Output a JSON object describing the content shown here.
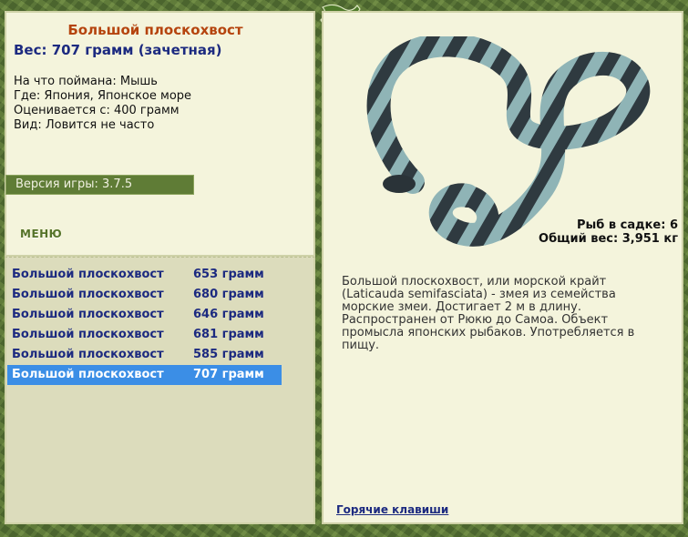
{
  "fish": {
    "title": "Большой плоскохвост",
    "weight": "Вес: 707 грамм (зачетная)",
    "details": [
      "На что поймана: Мышь",
      "Где: Япония, Японское море",
      "Оценивается с: 400 грамм",
      "Вид: Ловится не часто"
    ]
  },
  "version": "Версия игры: 3.7.5",
  "menu_label": "МЕНЮ",
  "stats": {
    "fish_in_keepnet": "Рыб в садке: 6",
    "total_weight": "Общий вес: 3,951 кг"
  },
  "catches": [
    {
      "name": "Большой плоскохвост",
      "weight": "653 грамм"
    },
    {
      "name": "Большой плоскохвост",
      "weight": "680 грамм"
    },
    {
      "name": "Большой плоскохвост",
      "weight": "646 грамм"
    },
    {
      "name": "Большой плоскохвост",
      "weight": "681 грамм"
    },
    {
      "name": "Большой плоскохвост",
      "weight": "585 грамм"
    },
    {
      "name": "Большой плоскохвост",
      "weight": "707 грамм"
    }
  ],
  "selected_catch_index": 5,
  "description": "Большой плоскохвост, или морской крайт (Laticauda semifasciata) - змея из семейства морские змеи. Достигает 2 м в длину. Распространен от Рюкю до Самоа. Объект промысла японских рыбаков. Употребляется в пищу.",
  "hotkeys_label": "Горячие клавиши",
  "colors": {
    "accent_title": "#b5440e",
    "link_blue": "#1c2a80",
    "selection": "#3b8ee6",
    "panel_bg": "#f4f4dc",
    "list_bg": "#dcdcbc",
    "version_bar": "#5f7c36"
  }
}
